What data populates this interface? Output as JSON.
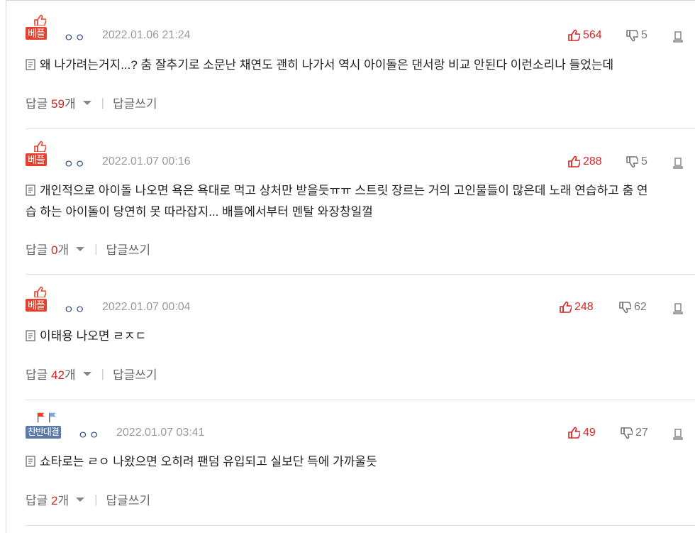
{
  "comments": [
    {
      "badge": "베플",
      "nick": "ㅇㅇ",
      "date": "2022.01.06 21:24",
      "up": "564",
      "down": "5",
      "text": "왜 나가려는거지...? 춤 잘추기로 소문난 채연도 괜히 나가서 역시 아이돌은 댄서랑 비교 안된다 이런소리나 들었는데",
      "reply_prefix": "답글",
      "reply_count": "59",
      "reply_suffix": "개",
      "write_reply": "답글쓰기"
    },
    {
      "badge": "베플",
      "nick": "ㅇㅇ",
      "date": "2022.01.07 00:16",
      "up": "288",
      "down": "5",
      "text_line1": "개인적으로 아이돌 나오면 욕은 욕대로 먹고 상처만 받을듯ㅠㅠ 스트릿 장르는 거의 고인물들이 많은데 노래 연습하고 춤 연",
      "text_line2": "습 하는 아이돌이 당연히 못 따라잡지... 배틀에서부터 멘탈 와장창일껄",
      "reply_prefix": "답글",
      "reply_count": "0",
      "reply_suffix": "개",
      "write_reply": "답글쓰기"
    },
    {
      "badge": "베플",
      "nick": "ㅇㅇ",
      "date": "2022.01.07 00:04",
      "up": "248",
      "down": "62",
      "text": "이태용 나오면 ㄹㅈㄷ",
      "reply_prefix": "답글",
      "reply_count": "42",
      "reply_suffix": "개",
      "write_reply": "답글쓰기"
    },
    {
      "badge": "찬반대결",
      "nick": "ㅇㅇ",
      "date": "2022.01.07 03:41",
      "up": "49",
      "down": "27",
      "text": "쇼타로는 ㄹㅇ 나왔으면 오히려 팬덤 유입되고 실보단 득에 가까울듯",
      "reply_prefix": "답글",
      "reply_count": "2",
      "reply_suffix": "개",
      "write_reply": "답글쓰기"
    }
  ],
  "icons": {
    "thumb_up": "thumbs-up-icon",
    "thumb_down": "thumbs-down-icon",
    "report": "report-icon",
    "document": "document-icon"
  },
  "colors": {
    "best_badge": "#e8402c",
    "vs_badge": "#5b7aa7",
    "up_count": "#d92525",
    "nick": "#2b4d8a"
  }
}
